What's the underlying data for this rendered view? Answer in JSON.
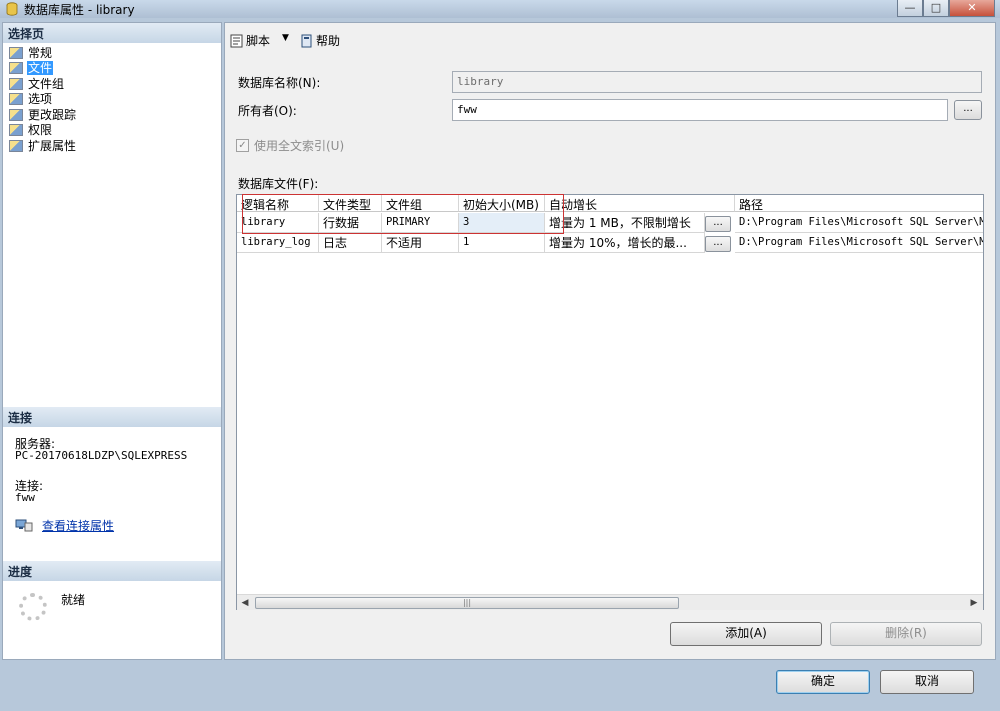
{
  "window": {
    "title": "数据库属性 - library"
  },
  "left": {
    "select_page_header": "选择页",
    "pages": [
      {
        "label": "常规"
      },
      {
        "label": "文件"
      },
      {
        "label": "文件组"
      },
      {
        "label": "选项"
      },
      {
        "label": "更改跟踪"
      },
      {
        "label": "权限"
      },
      {
        "label": "扩展属性"
      }
    ],
    "connection_header": "连接",
    "server_label": "服务器:",
    "server_value": "PC-20170618LDZP\\SQLEXPRESS",
    "connection_label": "连接:",
    "connection_value": "fww",
    "view_conn_props": "查看连接属性",
    "progress_header": "进度",
    "progress_status": "就绪"
  },
  "toolbar": {
    "script_label": "脚本",
    "help_label": "帮助"
  },
  "form": {
    "db_name_label": "数据库名称(N):",
    "db_name_value": "library",
    "owner_label": "所有者(O):",
    "owner_value": "fww",
    "ellipsis": "...",
    "fulltext_label": "使用全文索引(U)",
    "db_files_label": "数据库文件(F):"
  },
  "grid": {
    "columns": [
      "逻辑名称",
      "文件类型",
      "文件组",
      "初始大小(MB)",
      "自动增长",
      "路径"
    ],
    "rows": [
      {
        "logical_name": "library",
        "file_type": "行数据",
        "filegroup": "PRIMARY",
        "initial_size": "3",
        "autogrowth": "增量为 1 MB，不限制增长",
        "path": "D:\\Program Files\\Microsoft SQL Server\\MSSQ"
      },
      {
        "logical_name": "library_log",
        "file_type": "日志",
        "filegroup": "不适用",
        "initial_size": "1",
        "autogrowth": "增量为 10%，增长的最...",
        "path": "D:\\Program Files\\Microsoft SQL Server\\MSSQ"
      }
    ]
  },
  "buttons": {
    "add": "添加(A)",
    "remove": "删除(R)",
    "ok": "确定",
    "cancel": "取消"
  }
}
